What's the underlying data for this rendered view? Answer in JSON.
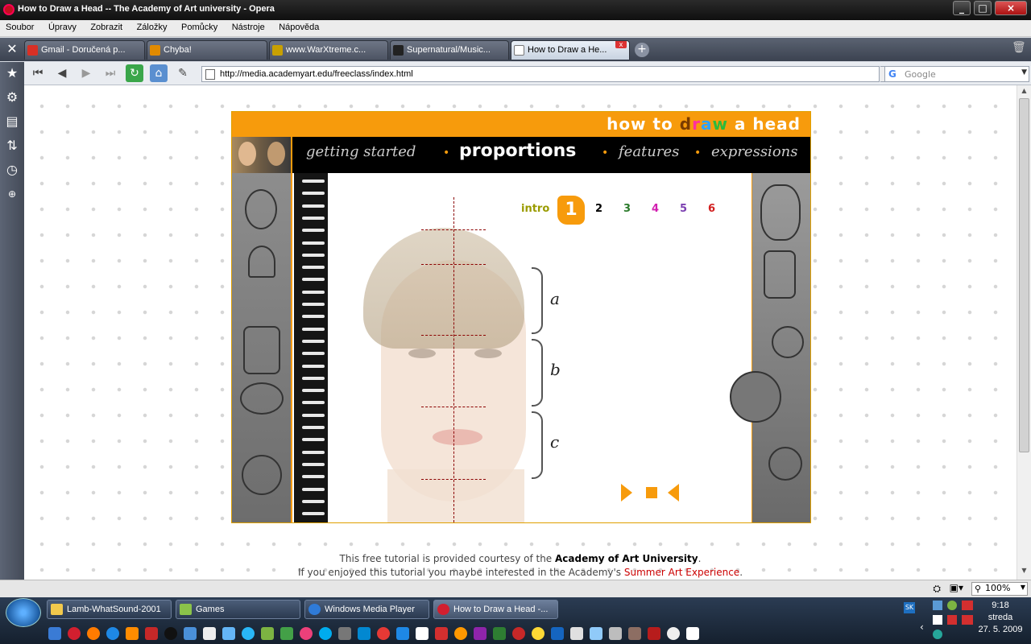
{
  "window": {
    "title": "How to Draw a Head -- The Academy of Art university - Opera"
  },
  "menu": [
    "Soubor",
    "Úpravy",
    "Zobrazit",
    "Záložky",
    "Pomůcky",
    "Nástroje",
    "Nápověda"
  ],
  "tabs": [
    {
      "label": "Gmail - Doručená p...",
      "icon": "gmail-icon",
      "color": "#d93025"
    },
    {
      "label": "Chyba!",
      "icon": "warning-icon",
      "color": "#e08a00"
    },
    {
      "label": "www.WarXtreme.c...",
      "icon": "warxtreme-icon",
      "color": "#c8a000"
    },
    {
      "label": "Supernatural/Music...",
      "icon": "tv-icon",
      "color": "#222222"
    },
    {
      "label": "How to Draw a He...",
      "icon": "page-icon",
      "color": "#ffffff"
    }
  ],
  "address": {
    "url": "http://media.academyart.edu/freeclass/index.html",
    "search_placeholder": "Google"
  },
  "app": {
    "title_parts": [
      "how to ",
      "d",
      "r",
      "a",
      "w",
      " a head"
    ],
    "nav": {
      "getting_started": "getting started",
      "proportions": "proportions",
      "features": "features",
      "expressions": "expressions",
      "bullet": "•"
    },
    "steps": {
      "intro": "intro",
      "current": "1",
      "others": [
        "2",
        "3",
        "4",
        "5",
        "6"
      ]
    },
    "brace_labels": [
      "a",
      "b",
      "c"
    ]
  },
  "footer": {
    "line1_prefix": "This free tutorial is provided courtesy of the ",
    "line1_link": "Academy of Art University",
    "line1_suffix": ".",
    "line2_prefix": "If you enjoyed this tutorial you maybe interested in the Academy's ",
    "line2_link": "Summer Art Experience",
    "line2_suffix": "."
  },
  "status": {
    "zoom": "100%"
  },
  "taskbar": {
    "buttons": [
      {
        "label": "Lamb-WhatSound-2001",
        "icon": "folder-icon",
        "color": "#f2c94c"
      },
      {
        "label": "Games",
        "icon": "games-icon",
        "color": "#8bc34a"
      },
      {
        "label": "Windows Media Player",
        "icon": "media-player-icon",
        "color": "#2f7bd8"
      },
      {
        "label": "How to Draw a Head -...",
        "icon": "opera-icon",
        "color": "#d21f2f"
      }
    ],
    "lang": "SK",
    "clock": {
      "time": "9:18",
      "day": "streda",
      "date": "27. 5. 2009"
    }
  }
}
